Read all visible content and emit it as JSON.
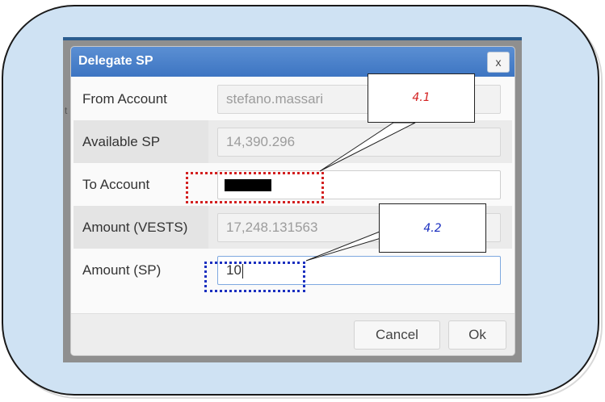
{
  "dialog": {
    "title": "Delegate SP",
    "close_label": "x",
    "rows": [
      {
        "label": "From Account",
        "value": "stefano.massari"
      },
      {
        "label": "Available SP",
        "value": "14,390.296"
      },
      {
        "label": "To Account",
        "value": ""
      },
      {
        "label": "Amount (VESTS)",
        "value": "17,248.131563"
      },
      {
        "label": "Amount (SP)",
        "value": "10"
      }
    ],
    "cancel_label": "Cancel",
    "ok_label": "Ok"
  },
  "annotations": {
    "callout_1": "4.1",
    "callout_2": "4.2",
    "callout_1_color": "#d32020",
    "callout_2_color": "#1a2fbf"
  },
  "background_fragment": "t"
}
